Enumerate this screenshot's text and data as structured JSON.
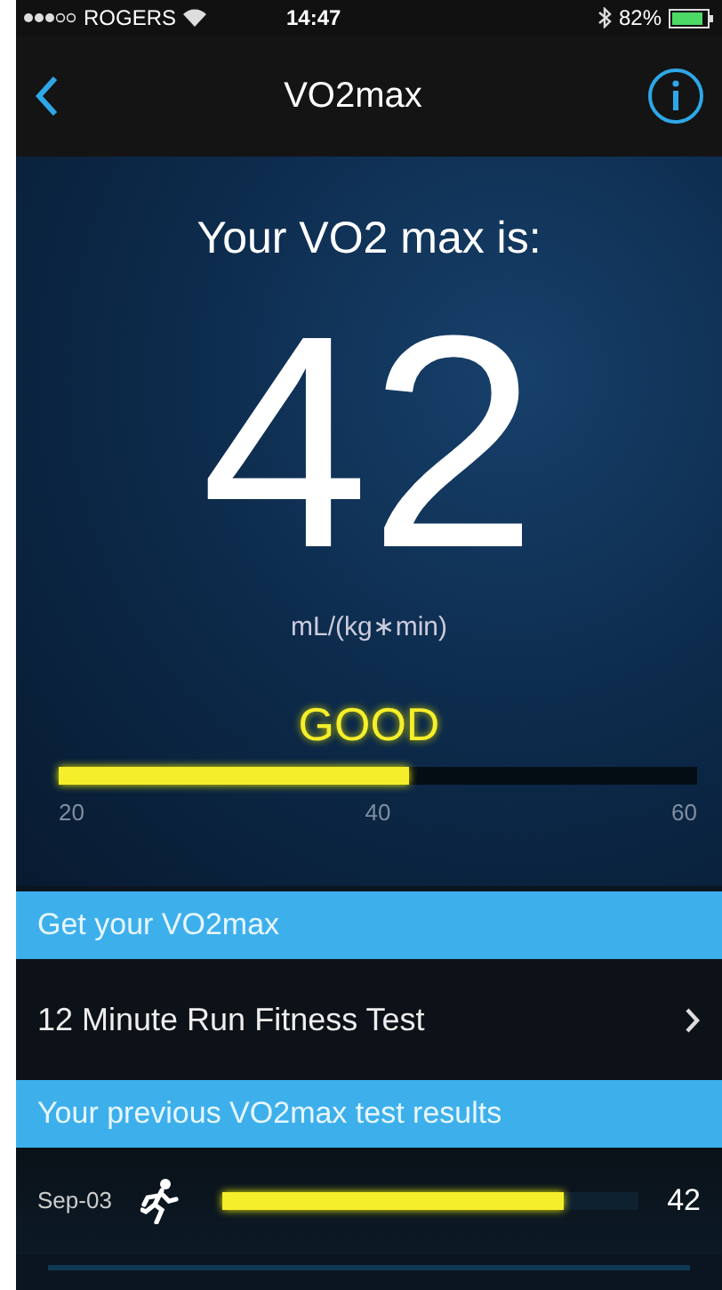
{
  "status_bar": {
    "carrier": "ROGERS",
    "time": "14:47",
    "battery": "82%"
  },
  "nav": {
    "title": "VO2max"
  },
  "result": {
    "heading": "Your VO2 max is:",
    "value": "42",
    "unit": "mL/(kg∗min)",
    "rating": "GOOD",
    "level": 0.55,
    "ticks": [
      "20",
      "40",
      "60"
    ]
  },
  "sections": [
    {
      "header": "Get your VO2max",
      "rows": [
        {
          "kind": "link",
          "label": "12 Minute Run Fitness Test"
        }
      ]
    },
    {
      "header": "Your previous VO2max test results",
      "rows": [
        {
          "kind": "result",
          "date": "Sep-03",
          "level": 0.82,
          "value": "42"
        }
      ]
    }
  ]
}
